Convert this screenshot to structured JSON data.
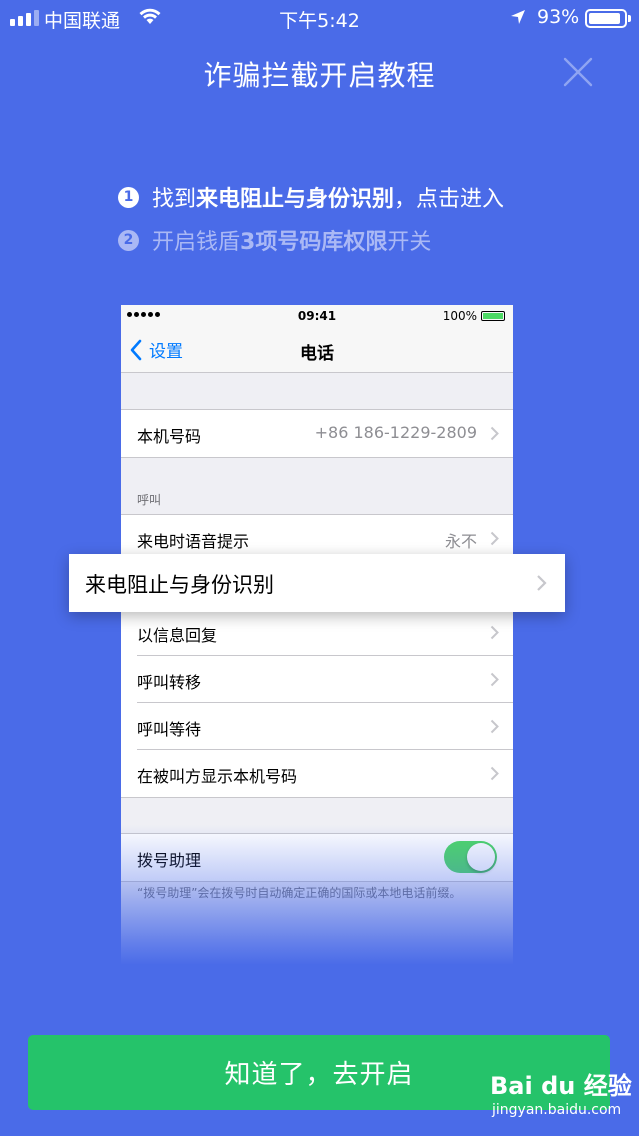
{
  "status_bar": {
    "carrier": "中国联通",
    "time": "下午5:42",
    "battery_pct": "93%",
    "battery_level": 0.93
  },
  "header": {
    "title": "诈骗拦截开启教程",
    "close_icon": "close-icon"
  },
  "steps": [
    {
      "num": "1",
      "pre": "找到 ",
      "bold": "来电阻止与身份识别",
      "post": "，点击进入"
    },
    {
      "num": "2",
      "pre": "开启钱盾 ",
      "bold": "3项号码库权限",
      "post": " 开关"
    }
  ],
  "phone": {
    "status": {
      "time": "09:41",
      "battery": "100%"
    },
    "nav": {
      "back_label": "设置",
      "title": "电话"
    },
    "my_number": {
      "label": "本机号码",
      "value": "+86 186-1229-2809"
    },
    "section_calls": "呼叫",
    "rows": [
      {
        "label": "来电时语音提示",
        "value": "永不"
      },
      {
        "label": "以信息回复"
      },
      {
        "label": "呼叫转移"
      },
      {
        "label": "呼叫等待"
      },
      {
        "label": "在被叫方显示本机号码"
      }
    ],
    "dial_assist": {
      "label": "拨号助理",
      "toggle_on": true
    },
    "footnote": "“拨号助理”会在拨号时自动确定正确的国际或本地电话前缀。"
  },
  "highlight": {
    "label": "来电阻止与身份识别"
  },
  "cta": {
    "label": "知道了，去开启"
  },
  "watermark": {
    "logo": "Bai du 经验",
    "url": "jingyan.baidu.com"
  },
  "colors": {
    "background": "#4a6be8",
    "cta": "#25c36a",
    "ios_blue": "#007aff",
    "toggle_green": "#4cd964"
  }
}
